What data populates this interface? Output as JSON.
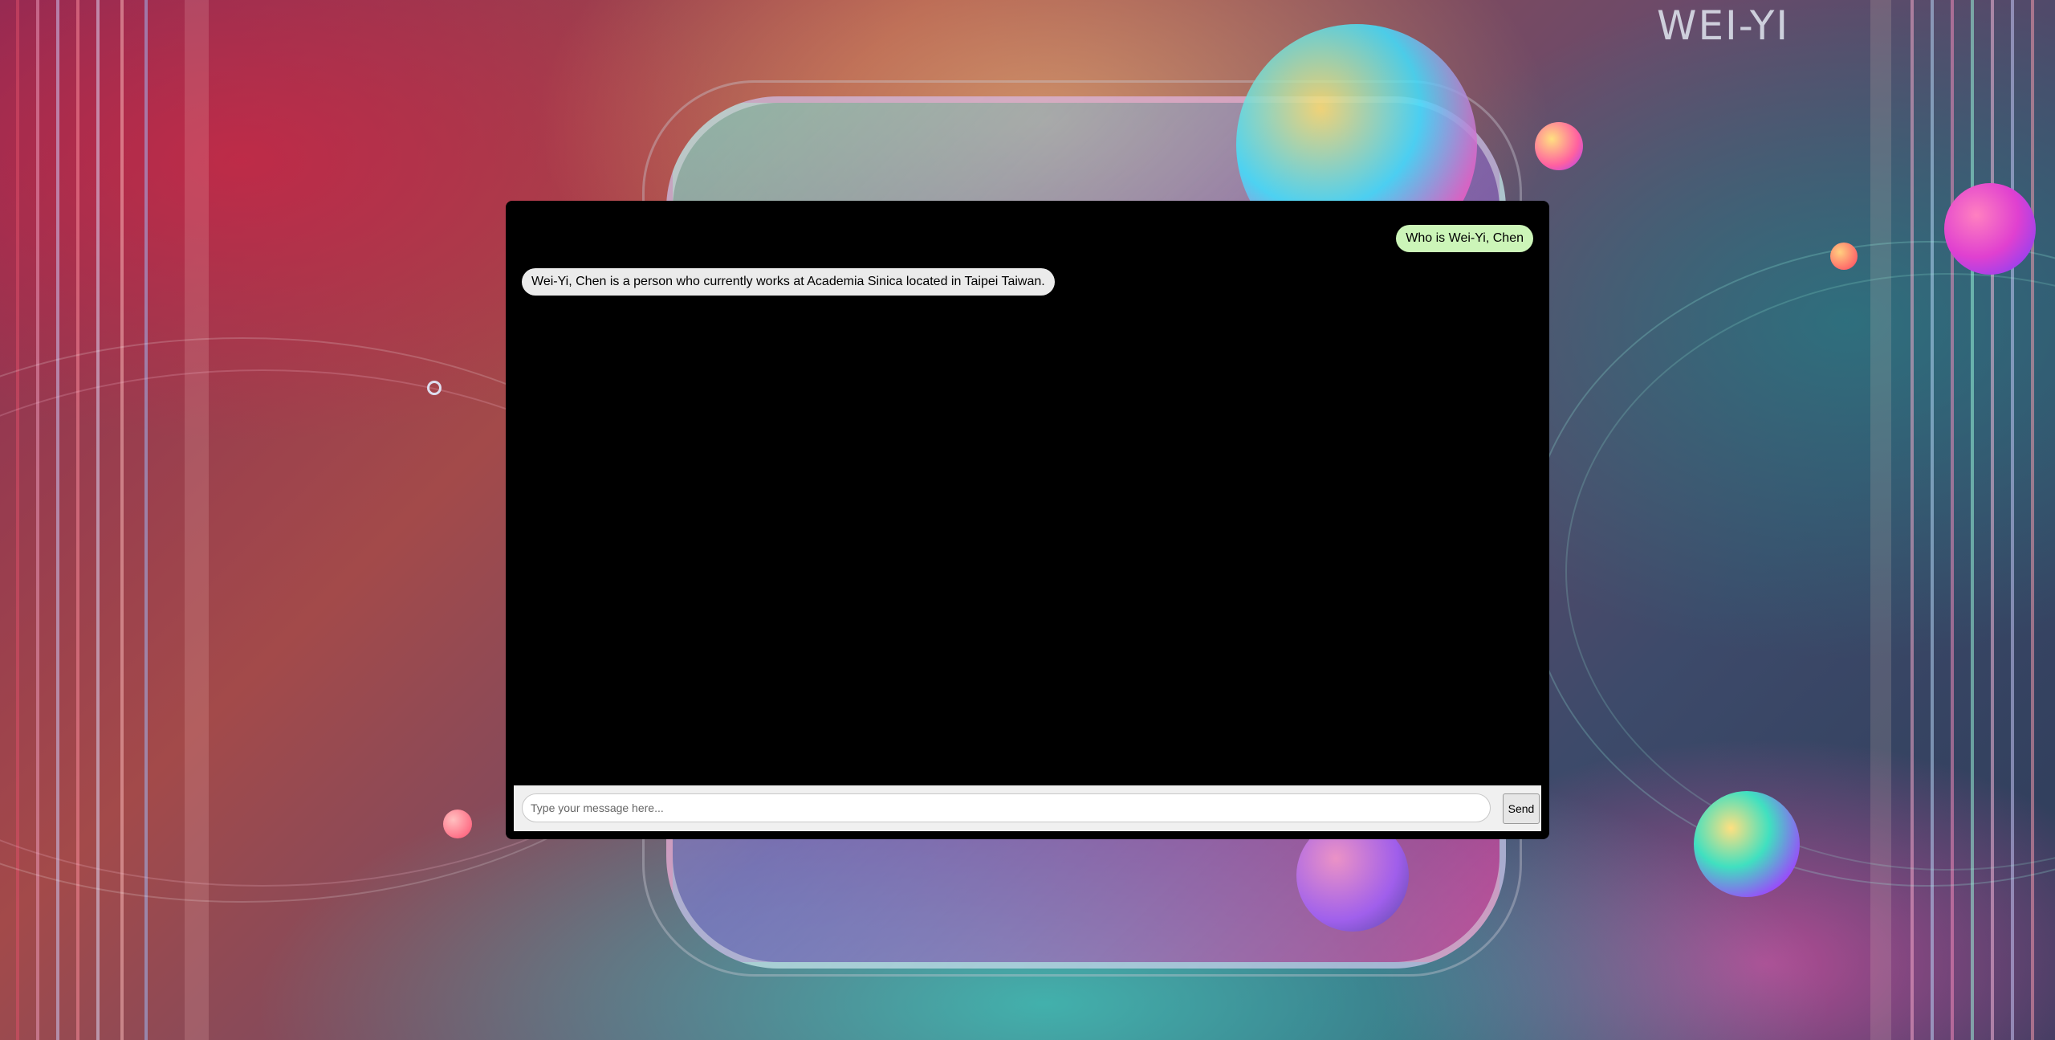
{
  "brand": {
    "title": "WEI-YI"
  },
  "chat": {
    "messages": [
      {
        "role": "user",
        "text": "Who is Wei-Yi, Chen"
      },
      {
        "role": "bot",
        "text": "Wei-Yi, Chen is a person who currently works at Academia Sinica located in Taipei Taiwan."
      }
    ]
  },
  "composer": {
    "placeholder": "Type your message here...",
    "value": "",
    "send_label": "Send"
  },
  "colors": {
    "chat_background": "#000000",
    "user_bubble": "#ccf5b8",
    "bot_bubble": "#ebebeb",
    "input_bar": "#f0f0f0"
  }
}
